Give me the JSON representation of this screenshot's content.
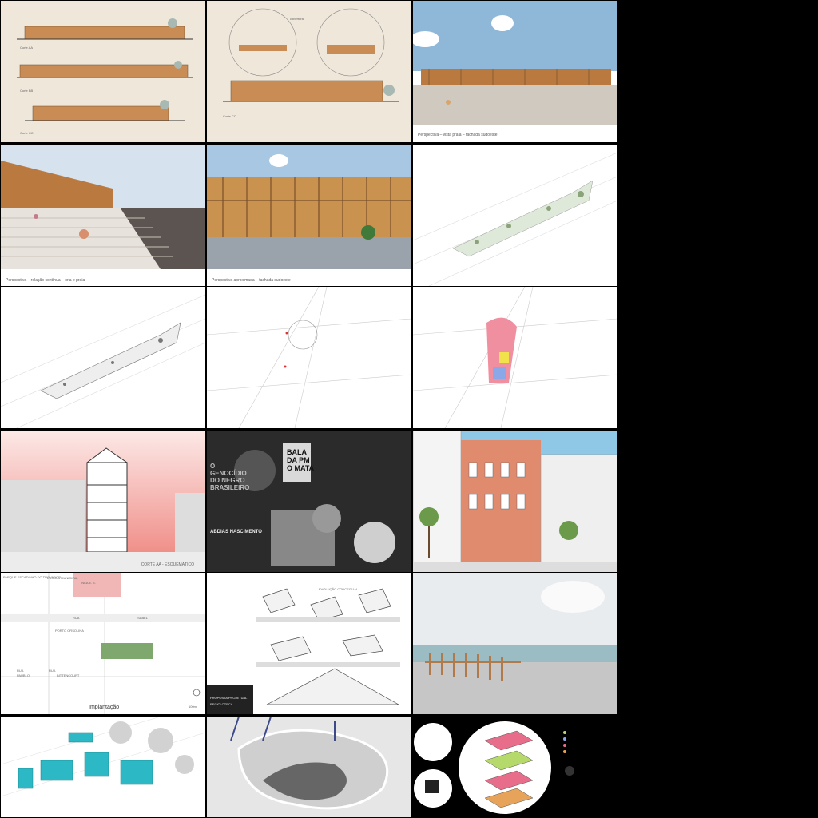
{
  "tiles": {
    "t1": {
      "labels": [
        "Corte AA",
        "Corte BB",
        "Corte CC"
      ]
    },
    "t2": {
      "labels": [
        "cobertura",
        "Corte CC"
      ]
    },
    "t3": {
      "caption": "Perspectiva – vista praia – fachada sudoeste"
    },
    "t4": {
      "caption": "Perspectiva – relação contínua – orla e praia"
    },
    "t5": {
      "caption": "Perspectiva aproximada – fachada sudoeste"
    },
    "t10": {
      "label": "CORTE AA - ESQUEMÁTICO"
    },
    "t11": {
      "title_lines": [
        "O",
        "GENOCÍDIO",
        "DO NEGRO",
        "BRASILEIRO"
      ],
      "name": "ABDIAS NASCIMENTO",
      "protest_lines": [
        "BALA",
        "DA PM",
        "O MATA"
      ]
    },
    "t13": {
      "labels": [
        "PARQUE ESCADINHO DO TROVADOR",
        "ESCOLA MUNICIPAL",
        "INCA E. E.",
        "RUA",
        "ISABEL",
        "PORTO ORSOLINA",
        "RUA",
        "BITTENCOURT",
        "RUA",
        "PAUBLO"
      ],
      "title": "Implantação",
      "scale": "100m"
    },
    "t14": {
      "label": "EVOLUÇÃO CONCEITUAL",
      "footer": [
        "PROPOSTA PROJETUAL",
        "RECICLOTECA"
      ]
    }
  },
  "colors": {
    "sky": "#8fb7d8",
    "wood": "#b9793f",
    "salmon": "#e07a5f",
    "cyan": "#2cb9c5",
    "pink": "#e76d8a"
  }
}
